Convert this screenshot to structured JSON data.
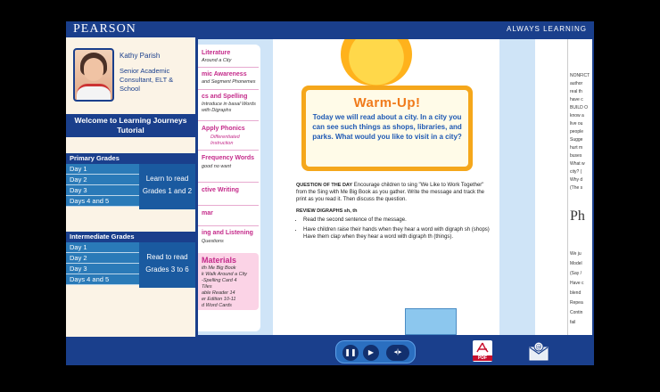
{
  "header": {
    "brand": "PEARSON",
    "tagline": "ALWAYS LEARNING"
  },
  "presenter": {
    "name": "Kathy Parish",
    "title": "Senior Academic Consultant, ELT & School"
  },
  "course": {
    "title": "Welcome to Learning Journeys Tutorial"
  },
  "primary": {
    "heading": "Primary Grades",
    "days": [
      "Day 1",
      "Day 2",
      "Day 3",
      "Days 4 and 5"
    ],
    "line1": "Learn to read",
    "line2": "Grades 1 and 2"
  },
  "intermediate": {
    "heading": "Intermediate Grades",
    "days": [
      "Day 1",
      "Day 2",
      "Day 3",
      "Days 4 and 5"
    ],
    "line1": "Read to read",
    "line2": "Grades 3 to 6"
  },
  "page": {
    "toc": [
      {
        "label": "Literature",
        "sub": "Around a City"
      },
      {
        "label": "mic Awareness",
        "sub": "and Segment Phonemes"
      },
      {
        "label": "cs and Spelling",
        "sub": "Introduce in basal  Words with Digraphs"
      },
      {
        "label": "Apply Phonics",
        "sub": "Differentiated Instruction"
      },
      {
        "label": "Frequency Words",
        "sub": "good   no  want"
      },
      {
        "label": "ctive Writing",
        "sub": ""
      },
      {
        "label": "mar",
        "sub": ""
      },
      {
        "label": "ing and Listening",
        "sub": "Questions"
      }
    ],
    "materials": {
      "label": "Materials",
      "items": [
        "ith Me Big Book",
        "k Walk Around a City",
        "-Spelling Card 4",
        "Tiles",
        "able Reader 14",
        "er Edition 10-11",
        "d Word Cards"
      ]
    },
    "warmup": {
      "title": "Warm-Up!",
      "text": "Today we will read about a city. In a city you can see such things as shops, libraries, and parks. What would you like to visit in a city?"
    },
    "lesson": {
      "q_label": "QUESTION OF THE DAY",
      "q_text": "Encourage children to sing \"We Like to Work Together\" from the Sing with Me Big Book as you gather. Write the message and track the print as you read it. Then discuss the question.",
      "r_label": "REVIEW DIGRAPHS sh, th",
      "bullets": [
        "Read the second sentence of the message.",
        "Have children raise their hands when they hear a word with digraph sh (shops) Have them clap when they hear a word with digraph th (things)."
      ]
    },
    "right_column": [
      "NONFICT",
      "author",
      "real th",
      "have c",
      "BUILD O",
      "know a",
      "live ou",
      "people",
      "Sugge",
      "hurt m",
      "buses",
      "What w",
      "city? (",
      "Why d",
      "(The s",
      "Ph",
      "We ju",
      "Model",
      "(Say /",
      "Have c",
      "blend",
      "Repea",
      "Contin",
      "fail"
    ]
  },
  "controls": {
    "pause": "❚❚",
    "play": "▶",
    "audio": "◂|▸",
    "pdf_label": "PDF"
  },
  "colors": {
    "brand_blue": "#1a3f8c",
    "accent_orange": "#f5a71b",
    "warmup_blue": "#1e59b3",
    "pdf_red": "#c8102e"
  }
}
